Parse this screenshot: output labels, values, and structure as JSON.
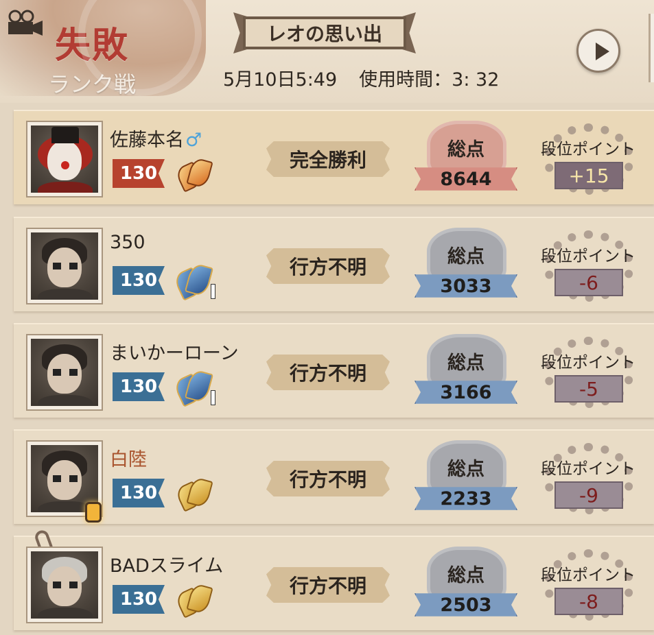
{
  "header": {
    "result": "失敗",
    "mode": "ランク戦",
    "map_name": "レオの思い出",
    "date_time": "5月10日5:49",
    "duration": "使用時間：3: 32"
  },
  "score_label": "総点",
  "rank_points_label": "段位ポイント",
  "players": [
    {
      "name": "佐藤本名",
      "gender_icon": "♂",
      "level": "130",
      "outcome": "完全勝利",
      "score": "8644",
      "rank_points": "+15",
      "role": "hunter"
    },
    {
      "name": "350",
      "level": "130",
      "outcome": "行方不明",
      "score": "3033",
      "rank_points": "-6",
      "role": "survivor"
    },
    {
      "name": "まいかーローン",
      "level": "130",
      "outcome": "行方不明",
      "score": "3166",
      "rank_points": "-5",
      "role": "survivor"
    },
    {
      "name": "白陸",
      "level": "130",
      "outcome": "行方不明",
      "score": "2233",
      "rank_points": "-9",
      "role": "survivor"
    },
    {
      "name": "BADスライム",
      "level": "130",
      "outcome": "行方不明",
      "score": "2503",
      "rank_points": "-8",
      "role": "survivor"
    }
  ],
  "colors": {
    "loss_red": "#b23c33",
    "survivor_blue": "#3b6f95",
    "hunter_red": "#b7432e"
  }
}
